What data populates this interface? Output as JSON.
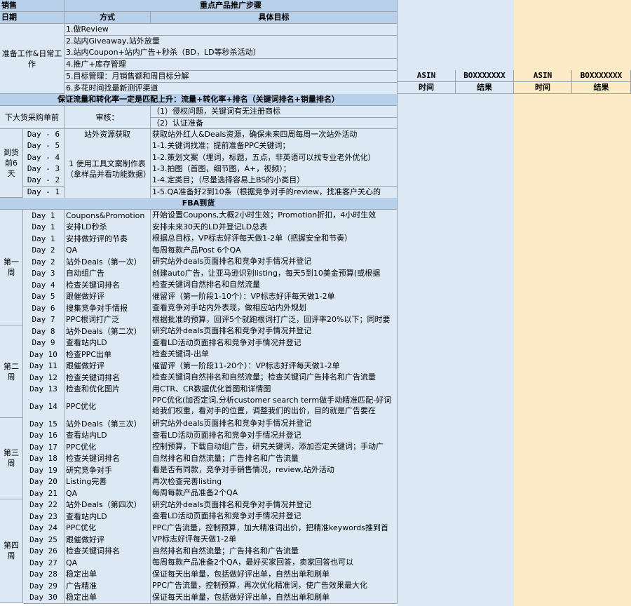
{
  "header": {
    "sales": "销售",
    "date": "日期",
    "title": "重点产品推广步骤",
    "col_method": "方式",
    "col_goal": "具体目标"
  },
  "prep": {
    "label": "准备工作&日常工作",
    "items": [
      "1.做Review",
      "2.站内Giveaway,站外放量",
      "3.站内Coupon+站内广告+秒杀（BD，LD等秒杀活动）",
      "4.推广+库存管理",
      "5.目标管理：月销售额和周目标分解",
      "6.多花时间找最新测评渠道"
    ]
  },
  "asin_table": {
    "row1": [
      "ASIN",
      "BOXXXXXXX",
      "ASIN",
      "BOXXXXXXX"
    ],
    "row2": [
      "时间",
      "结果",
      "时间",
      "结果"
    ]
  },
  "banner": "保证流量和转化率一定是匹配上升：流量+转化率+排名（关键词排名+销量排名）",
  "predelivery": {
    "label": "下大货采购单前",
    "review_label": "审核：",
    "lines": [
      "（1）侵权问题，关键词有无注册商标",
      "（2）认证准备"
    ]
  },
  "arrival": {
    "label": "到货前6天",
    "days": [
      "Day - 6",
      "Day - 5",
      "Day - 4",
      "Day - 3",
      "Day - 2",
      "Day - 1"
    ],
    "method_first": "站外资源获取",
    "method_rest": "1 使用工具文案制作表（拿样品并看功能数据）",
    "goals": [
      "获取站外红人&Deals资源，确保未来四周每周一次站外活动",
      "1-1.关键词找准；提前准备PPC关键词；",
      "1-2.策划文案（埋词，标题，五点，非英语可以找专业老外优化）",
      "1-3.拍图（首图，细节图，A+，视频）；",
      "1-4.定类目；（尽量选择容易上BS的小类目）",
      "1-5.QA准备好2到10条（根据竞争对手的review，找准客户关心的"
    ]
  },
  "fba_title": "FBA到货",
  "weeks": [
    {
      "label": "第一周",
      "rows": [
        {
          "day": "Day 1",
          "method": "Coupons&Promotion",
          "goal": "开始设置Coupons,大概2小时生效；Promotion折扣，4小时生效"
        },
        {
          "day": "Day 1",
          "method": "安排LD秒杀",
          "goal": "安排未来30天的LD并登记LD总表"
        },
        {
          "day": "Day 1",
          "method": "安排做好评的节奏",
          "goal": "根据总目标，VP标志好评每天做1-2单（把握安全和节奏）"
        },
        {
          "day": "Day 2",
          "method": "QA",
          "goal": "每周每款产品Post 6个QA"
        },
        {
          "day": "Day 2",
          "method": "站外Deals（第一次）",
          "goal": "研究站外deals页面排名和竞争对手情况并登记"
        },
        {
          "day": "Day 3",
          "method": "自动组广告",
          "goal": "创建auto广告，让亚马逊识别listing，每天5到10美金预算(或根据"
        },
        {
          "day": "Day 4",
          "method": "检查关键词排名",
          "goal": "检查关键词自然排名和自然流量"
        },
        {
          "day": "Day 5",
          "method": "跟催做好评",
          "goal": "催留评（第一阶段1-10个）：VP标志好评每天做1-2单"
        },
        {
          "day": "Day 6",
          "method": "搜集竞争对手情报",
          "goal": "查看竞争对手站内外表现，做相应站内外规划"
        },
        {
          "day": "Day 7",
          "method": "PPC根词打广泛",
          "goal": "根据批准的预算，回评5个就跑根词打广泛，回评率20%以下；同时要"
        }
      ]
    },
    {
      "label": "第二周",
      "rows": [
        {
          "day": "Day 8",
          "method": "站外Deals（第二次）",
          "goal": "研究站外deals页面排名和竞争对手情况并登记"
        },
        {
          "day": "Day 9",
          "method": "查看站内LD",
          "goal": "查看LD活动页面排名和竞争对手情况并登记"
        },
        {
          "day": "Day 10",
          "method": "检查PPC出单",
          "goal": "检查关键词-出单"
        },
        {
          "day": "Day 11",
          "method": "跟催做好评",
          "goal": "催留评（第一阶段11-20个）：VP标志好评每天做1-2单"
        },
        {
          "day": "Day 12",
          "method": "检查关键词排名",
          "goal": "检查关键词自然排名和自然流量；检查关键词广告排名和广告流量"
        },
        {
          "day": "Day 13",
          "method": "检查和优化图片",
          "goal": "用CTR、CR数据优化首图和详情图"
        },
        {
          "day": "Day 14",
          "method": "PPC优化",
          "goal": "PPC优化(加否定词,分析customer search term做手动精准匹配-好词给我们权重，看对手的位置，调整我们的出价，目的就是广告要在"
        }
      ]
    },
    {
      "label": "第三周",
      "rows": [
        {
          "day": "Day 15",
          "method": "站外Deals（第三次）",
          "goal": "研究站外deals页面排名和竞争对手情况并登记"
        },
        {
          "day": "Day 16",
          "method": "查看站内LD",
          "goal": "查看LD活动页面排名和竞争对手情况并登记"
        },
        {
          "day": "Day 17",
          "method": "PPC优化",
          "goal": "控制预算，下载自动组广告，研究关键词，添加否定关键词；手动广"
        },
        {
          "day": "Day 18",
          "method": "检查关键词排名",
          "goal": "自然排名和自然流量；广告排名和广告流量"
        },
        {
          "day": "Day 19",
          "method": "研究竞争对手",
          "goal": "看是否有同款，竞争对手销售情况，review,站外活动"
        },
        {
          "day": "Day 20",
          "method": "Listing完善",
          "goal": "再次检查完善listing"
        },
        {
          "day": "Day 21",
          "method": "QA",
          "goal": "每周每款产品准备2个QA"
        }
      ]
    },
    {
      "label": "第四周",
      "rows": [
        {
          "day": "Day 22",
          "method": "站外Deals（第四次）",
          "goal": "研究站外deals页面排名和竞争对手情况并登记"
        },
        {
          "day": "Day 23",
          "method": "查看站内LD",
          "goal": "查看LD活动页面排名和竞争对手情况并登记"
        },
        {
          "day": "Day 24",
          "method": "PPC优化",
          "goal": "PPC广告流量，控制预算，加大精准词出价，把精准keywords推到首"
        },
        {
          "day": "Day 25",
          "method": "跟催做好评",
          "goal": "VP标志好评每天做1-2单"
        },
        {
          "day": "Day 26",
          "method": "检查关键词排名",
          "goal": "自然排名和自然流量；广告排名和广告流量"
        },
        {
          "day": "Day 27",
          "method": "QA",
          "goal": "每周每款产品准备2个QA，最好买家回答，卖家回答也可以"
        },
        {
          "day": "Day 28",
          "method": "稳定出单",
          "goal": "保证每天出单量，包括做好评出单，自然出单和刷单"
        },
        {
          "day": "Day 29",
          "method": "广告精准",
          "goal": "PPC广告流量，控制预算，再次优化精准词，使广告效果最大化"
        },
        {
          "day": "Day 30",
          "method": "稳定出单",
          "goal": "保证每天出单量，包括做好评出单，自然出单和刷单"
        }
      ]
    }
  ]
}
